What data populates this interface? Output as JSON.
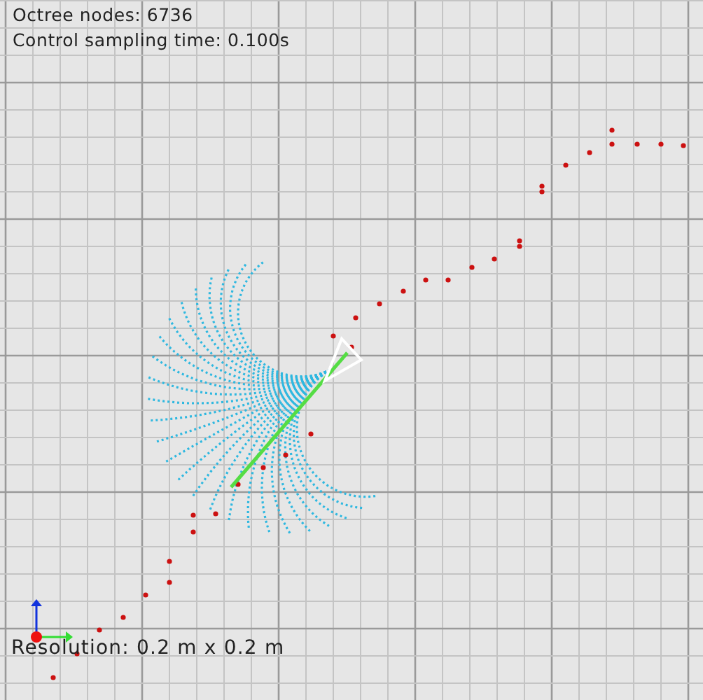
{
  "info_lines": [
    "Octree nodes: 6736",
    "Control sampling time: 0.100s"
  ],
  "resolution_label": "Resolution: 0.2 m x 0.2 m"
}
